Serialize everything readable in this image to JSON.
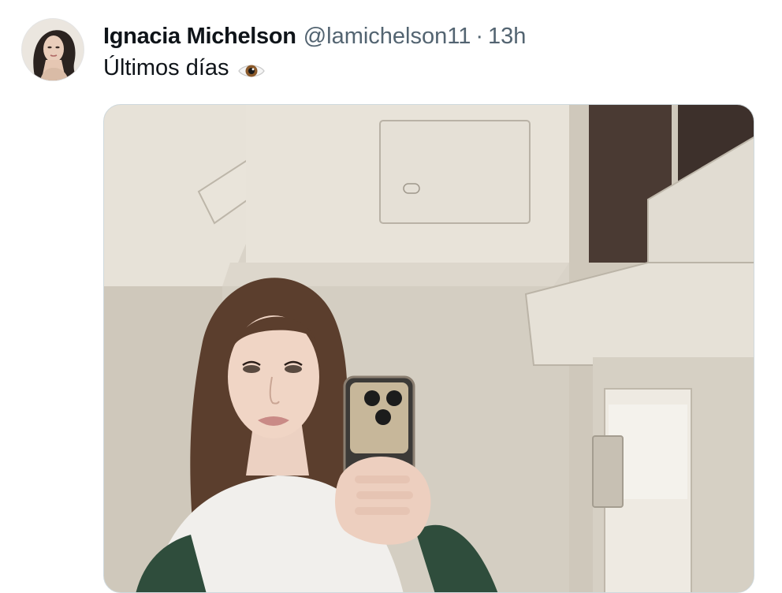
{
  "author": {
    "display_name": "Ignacia Michelson",
    "handle": "@lamichelson11",
    "separator": "·",
    "time": "13h",
    "avatar_icon": "profile-photo"
  },
  "tweet": {
    "text": "Últimos días",
    "emoji_icon": "eye-icon"
  },
  "media": {
    "type": "photo",
    "description_icon": "airplane-lavatory-selfie-photo"
  },
  "colors": {
    "text_primary": "#0f1419",
    "text_secondary": "#536471",
    "border": "#cfd9de"
  }
}
